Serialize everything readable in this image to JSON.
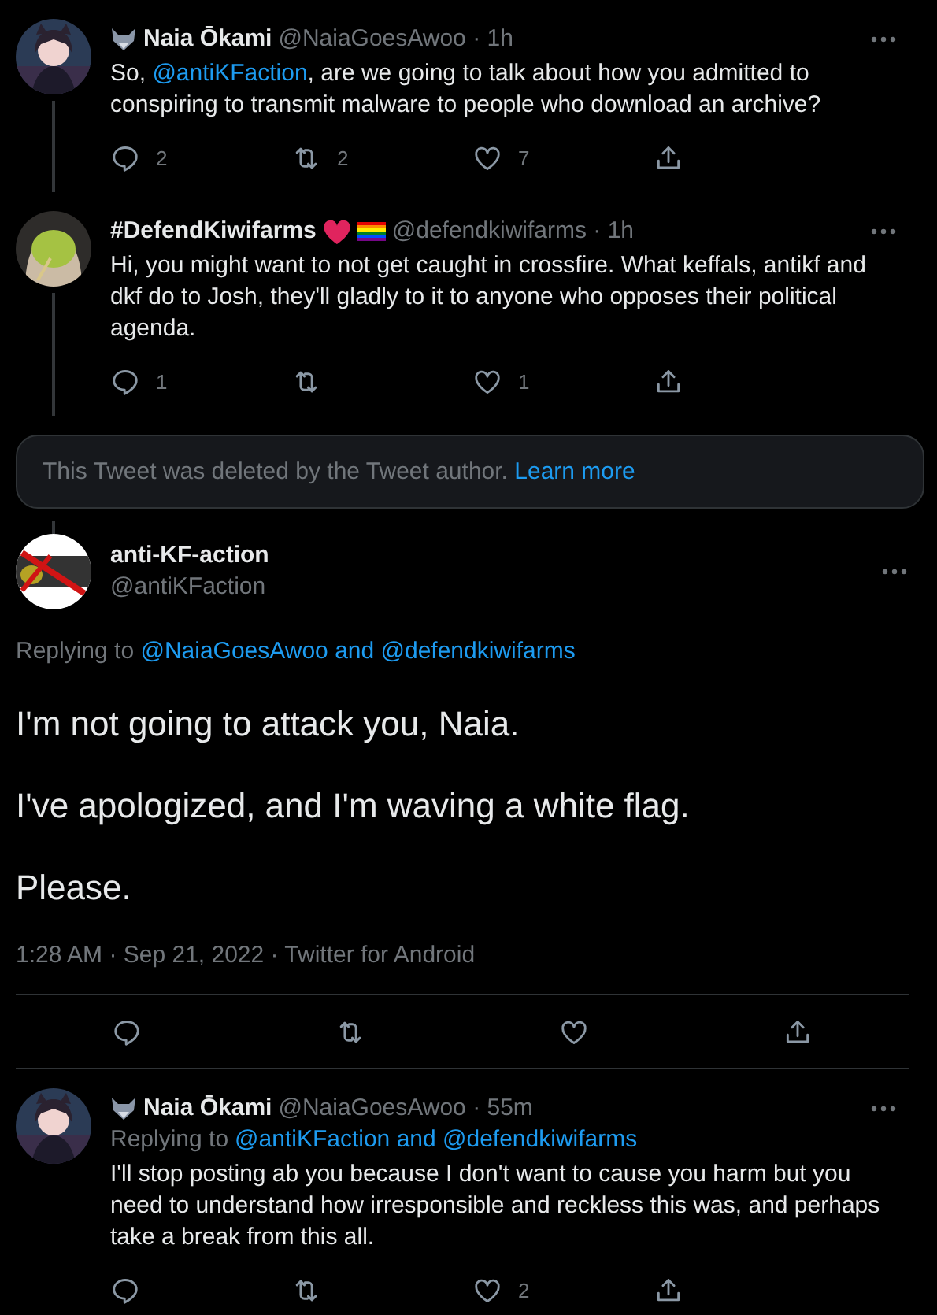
{
  "thread": [
    {
      "name": "Naia Ōkami",
      "handle": "@NaiaGoesAwoo",
      "time": "· 1h",
      "body": [
        {
          "text": "So, "
        },
        {
          "text": "@antiKFaction",
          "link": true
        },
        {
          "text": ", are we going to talk about how you admitted to conspiring to transmit malware to people who download an archive?"
        }
      ],
      "actions": [
        {
          "kind": "reply",
          "count": "2"
        },
        {
          "kind": "retweet",
          "count": "2"
        },
        {
          "kind": "like",
          "count": "7"
        },
        {
          "kind": "share"
        }
      ]
    },
    {
      "name": "#DefendKiwifarms",
      "handle": "@defendkiwifarms",
      "time": "· 1h",
      "body": [
        {
          "text": "Hi, you might want to not get caught in crossfire. What keffals, antikf and dkf do to Josh, they'll gladly to it to anyone who opposes their political agenda."
        }
      ],
      "actions": [
        {
          "kind": "reply",
          "count": "1"
        },
        {
          "kind": "retweet"
        },
        {
          "kind": "like",
          "count": "1"
        },
        {
          "kind": "share"
        }
      ]
    }
  ],
  "deleted_notice": {
    "text": "This Tweet was deleted by the Tweet author.",
    "link": "Learn more"
  },
  "main_tweet": {
    "name": "anti-KF-action",
    "handle": "@antiKFaction",
    "replying_label": "Replying to",
    "replying_link": "@NaiaGoesAwoo and @defendkiwifarms",
    "paragraphs": [
      "I'm not going to attack you, Naia.",
      "I've apologized, and I'm waving a white flag.",
      "Please."
    ],
    "meta": "1:28 AM · Sep 21, 2022 · Twitter for Android",
    "actions": [
      {
        "kind": "reply"
      },
      {
        "kind": "retweet"
      },
      {
        "kind": "like"
      },
      {
        "kind": "share"
      }
    ]
  },
  "replies": [
    {
      "name": "Naia Ōkami",
      "handle": "@NaiaGoesAwoo",
      "time": "· 55m",
      "replying_label": "Replying to",
      "replying_link": "@antiKFaction and @defendkiwifarms",
      "body": [
        {
          "text": "I'll stop posting ab you because I don't want to cause you harm but you need to understand how irresponsible and reckless this was, and perhaps take a break from this all."
        }
      ],
      "actions": [
        {
          "kind": "reply"
        },
        {
          "kind": "retweet"
        },
        {
          "kind": "like",
          "count": "2"
        },
        {
          "kind": "share"
        }
      ]
    }
  ]
}
